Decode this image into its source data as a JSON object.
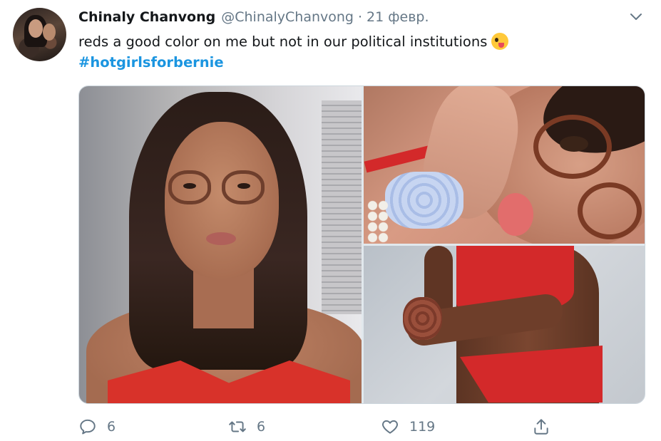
{
  "tweet": {
    "author_name": "Chinaly Chanvong",
    "handle": "@ChinalyChanvong",
    "separator": "·",
    "date": "21 февр.",
    "text": "reds a good color on me but not in our political institutions",
    "hashtag": "#hotgirlsforbernie",
    "emoji": "zany-face"
  },
  "media": {
    "photos": [
      {
        "subject": "woman-glasses-red-top"
      },
      {
        "subject": "woman-glasses-closeup"
      },
      {
        "subject": "torso-red-bikini"
      }
    ]
  },
  "actions": {
    "reply_count": "6",
    "retweet_count": "6",
    "like_count": "119"
  },
  "icons": {
    "reply": "reply-icon",
    "retweet": "retweet-icon",
    "like": "heart-icon",
    "share": "share-icon",
    "menu": "chevron-down-icon"
  },
  "colors": {
    "link": "#1b95e0",
    "secondary_text": "#657786",
    "primary_text": "#14171a"
  }
}
